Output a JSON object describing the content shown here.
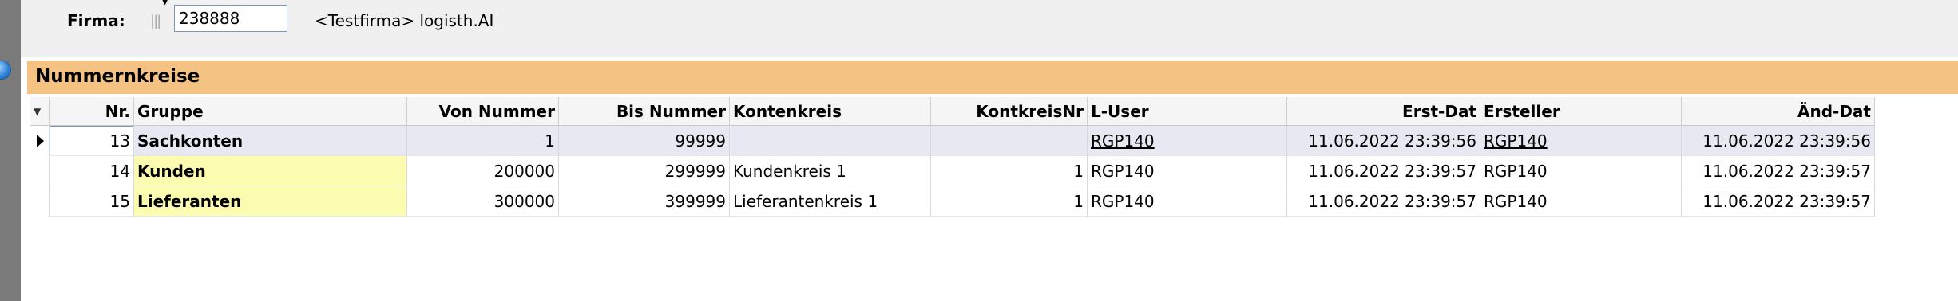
{
  "filter": {
    "firma_label": "Firma:",
    "firma_value": "238888",
    "firma_description": "<Testfirma> logisth.AI"
  },
  "section": {
    "title": "Nummernkreise"
  },
  "table": {
    "headers": {
      "nr": "Nr.",
      "gruppe": "Gruppe",
      "von": "Von Nummer",
      "bis": "Bis Nummer",
      "kontenkreis": "Kontenkreis",
      "kontkreisnr": "KontkreisNr",
      "luser": "L-User",
      "erstdat": "Erst-Dat",
      "ersteller": "Ersteller",
      "aenddat": "Änd-Dat"
    },
    "rows": [
      {
        "nr": "13",
        "gruppe": "Sachkonten",
        "von": "1",
        "bis": "99999",
        "kontenkreis": "",
        "kontkreisnr": "",
        "luser": "RGP140",
        "erstdat": "11.06.2022 23:39:56",
        "ersteller": "RGP140",
        "aenddat": "11.06.2022 23:39:56"
      },
      {
        "nr": "14",
        "gruppe": "Kunden",
        "von": "200000",
        "bis": "299999",
        "kontenkreis": "Kundenkreis 1",
        "kontkreisnr": "1",
        "luser": "RGP140",
        "erstdat": "11.06.2022 23:39:57",
        "ersteller": "RGP140",
        "aenddat": "11.06.2022 23:39:57"
      },
      {
        "nr": "15",
        "gruppe": "Lieferanten",
        "von": "300000",
        "bis": "399999",
        "kontenkreis": "Lieferantenkreis 1",
        "kontkreisnr": "1",
        "luser": "RGP140",
        "erstdat": "11.06.2022 23:39:57",
        "ersteller": "RGP140",
        "aenddat": "11.06.2022 23:39:57"
      }
    ]
  }
}
